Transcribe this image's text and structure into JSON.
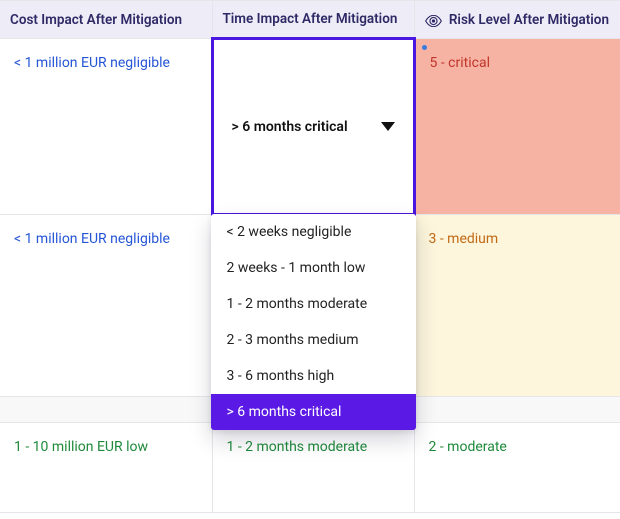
{
  "columns": {
    "cost": "Cost Impact After Mitigation",
    "time": "Time Impact After Mitigation",
    "risk": "Risk Level After Mitigation"
  },
  "rows": [
    {
      "cost": "< 1 million EUR negligible",
      "time_selected": "> 6 months critical",
      "risk": "5 - critical"
    },
    {
      "cost": "< 1 million EUR negligible",
      "time": "",
      "risk": "3 - medium"
    },
    {
      "cost": "1 - 10 million EUR low",
      "time": "1 - 2 months moderate",
      "risk": "2 - moderate"
    }
  ],
  "time_options": [
    "< 2 weeks negligible",
    "2 weeks - 1 month low",
    "1 - 2 months moderate",
    "2 - 3 months medium",
    "3 - 6 months high",
    "> 6 months critical"
  ],
  "selected_time_option_index": 5
}
